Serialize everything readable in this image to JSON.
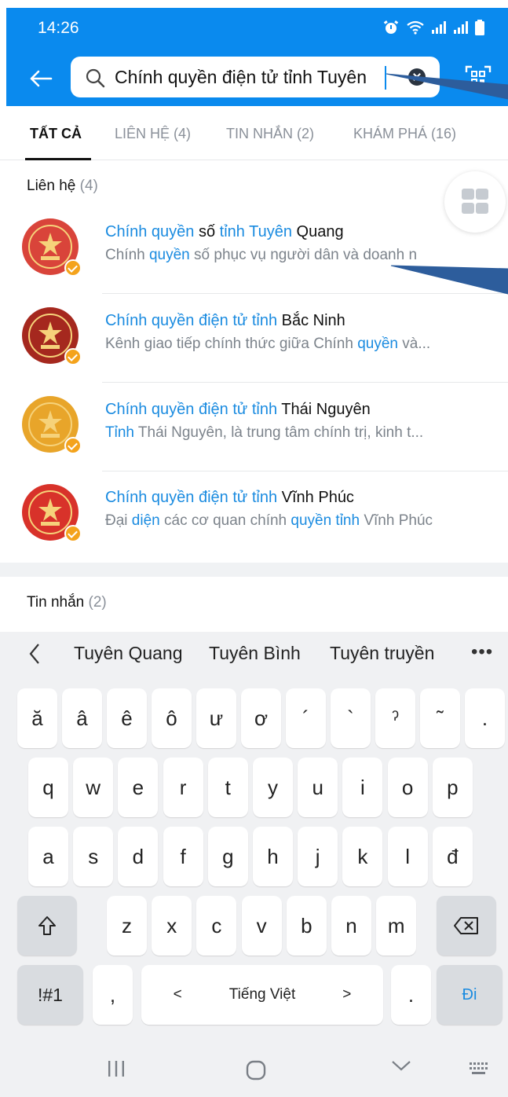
{
  "status_bar": {
    "time": "14:26"
  },
  "search": {
    "query": "Chính quyền điện tử tỉnh Tuyên"
  },
  "tabs": [
    {
      "label": "TẤT CẢ",
      "active": true
    },
    {
      "label": "LIÊN HỆ (4)",
      "active": false
    },
    {
      "label": "TIN NHẮN (2)",
      "active": false
    },
    {
      "label": "KHÁM PHÁ (16)",
      "active": false
    }
  ],
  "contacts_section": {
    "title": "Liên hệ",
    "count": "(4)",
    "items": [
      {
        "name_parts": [
          [
            "Chính quyền",
            true
          ],
          [
            " số ",
            false
          ],
          [
            "tỉnh Tuyên",
            true
          ],
          [
            " Quang",
            false
          ]
        ],
        "desc_parts": [
          [
            "Chính ",
            false
          ],
          [
            "quyền",
            true
          ],
          [
            " số phục vụ người dân và doanh n",
            false
          ]
        ],
        "avatar_color": "#d9443a"
      },
      {
        "name_parts": [
          [
            "Chính quyền điện tử tỉnh",
            true
          ],
          [
            " Bắc Ninh",
            false
          ]
        ],
        "desc_parts": [
          [
            "Kênh giao tiếp chính thức giữa Chính ",
            false
          ],
          [
            "quyền",
            true
          ],
          [
            " và...",
            false
          ]
        ],
        "avatar_color": "#a5281e"
      },
      {
        "name_parts": [
          [
            "Chính quyền điện tử tỉnh",
            true
          ],
          [
            " Thái Nguyên",
            false
          ]
        ],
        "desc_parts": [
          [
            "Tỉnh",
            true
          ],
          [
            " Thái Nguyên, là trung tâm chính trị, kinh t...",
            false
          ]
        ],
        "avatar_color": "#e8a52a"
      },
      {
        "name_parts": [
          [
            "Chính quyền điện tử tỉnh",
            true
          ],
          [
            " Vĩnh Phúc",
            false
          ]
        ],
        "desc_parts": [
          [
            "Đại ",
            false
          ],
          [
            "diện",
            true
          ],
          [
            " các cơ quan chính ",
            false
          ],
          [
            "quyền tỉnh",
            true
          ],
          [
            " Vĩnh Phúc",
            false
          ]
        ],
        "avatar_color": "#d8322a"
      }
    ]
  },
  "messages_section": {
    "title": "Tin nhắn",
    "count": "(2)"
  },
  "keyboard": {
    "suggestions": [
      "Tuyên Quang",
      "Tuyên Bình",
      "Tuyên truyền"
    ],
    "more": "•••",
    "row0": [
      "ă",
      "â",
      "ê",
      "ô",
      "ư",
      "ơ",
      "´",
      "`",
      "ˀ",
      "˜",
      "."
    ],
    "row1": [
      "q",
      "w",
      "e",
      "r",
      "t",
      "y",
      "u",
      "i",
      "o",
      "p"
    ],
    "row2": [
      "a",
      "s",
      "d",
      "f",
      "g",
      "h",
      "j",
      "k",
      "l",
      "đ"
    ],
    "row3": [
      "z",
      "x",
      "c",
      "v",
      "b",
      "n",
      "m"
    ],
    "symbols_label": "!#1",
    "comma": ",",
    "space_label": "Tiếng Việt",
    "space_left": "<",
    "space_right": ">",
    "period": ".",
    "go_label": "Đi"
  },
  "colors": {
    "header_blue": "#0a8aee",
    "highlight": "#1a8be0",
    "verified": "#f4a31c"
  }
}
